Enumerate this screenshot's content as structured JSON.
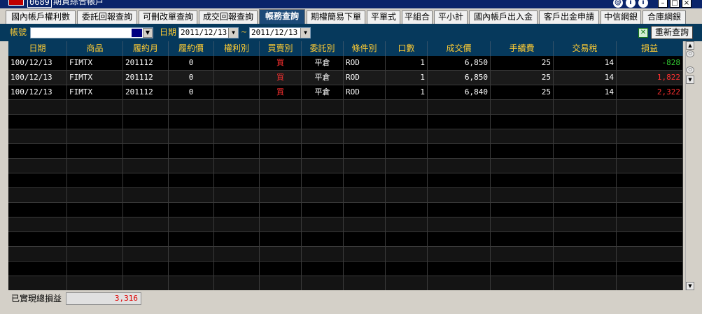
{
  "window": {
    "code": "0689",
    "title": "期貨綜合帳戶",
    "buttons": [
      "@",
      "i",
      "i",
      "–",
      "□",
      "×"
    ]
  },
  "tabs": [
    {
      "label": "國內帳戶權利數",
      "active": false
    },
    {
      "label": "委託回報查詢",
      "active": false
    },
    {
      "label": "可刪改單查詢",
      "active": false
    },
    {
      "label": "成交回報查詢",
      "active": false
    },
    {
      "label": "帳務查詢",
      "active": true
    },
    {
      "label": "期權簡易下單",
      "active": false
    },
    {
      "label": "平單式",
      "active": false
    },
    {
      "label": "平組合",
      "active": false
    },
    {
      "label": "平小計",
      "active": false
    },
    {
      "label": "國內帳戶出入金",
      "active": false
    },
    {
      "label": "客戶出金申請",
      "active": false
    },
    {
      "label": "中信網銀",
      "active": false
    },
    {
      "label": "合庫網銀",
      "active": false
    }
  ],
  "toolbar": {
    "account_label": "帳號",
    "account_value": "",
    "date_label": "日期",
    "date_from": "2011/12/13",
    "date_sep": "~",
    "date_to": "2011/12/13",
    "export_icon": "excel-export-icon",
    "requery_label": "重新查詢"
  },
  "table": {
    "columns": [
      "日期",
      "商品",
      "履約月",
      "履約價",
      "權利別",
      "買賣別",
      "委託別",
      "條件別",
      "口數",
      "成交價",
      "手續費",
      "交易稅",
      "損益"
    ],
    "rows": [
      [
        "100/12/13",
        "FIMTX",
        "201112",
        "0",
        "",
        "買",
        "平倉",
        "ROD",
        "1",
        "6,850",
        "25",
        "14",
        "-828"
      ],
      [
        "100/12/13",
        "FIMTX",
        "201112",
        "0",
        "",
        "買",
        "平倉",
        "ROD",
        "1",
        "6,850",
        "25",
        "14",
        "1,822"
      ],
      [
        "100/12/13",
        "FIMTX",
        "201112",
        "0",
        "",
        "買",
        "平倉",
        "ROD",
        "1",
        "6,840",
        "25",
        "14",
        "2,322"
      ]
    ],
    "pnl_colors": {
      "negative": "#33cc33",
      "positive": "#ff3030"
    },
    "buy_color": "#ff3030"
  },
  "footer": {
    "label": "已實現總損益",
    "value": "3,316"
  }
}
